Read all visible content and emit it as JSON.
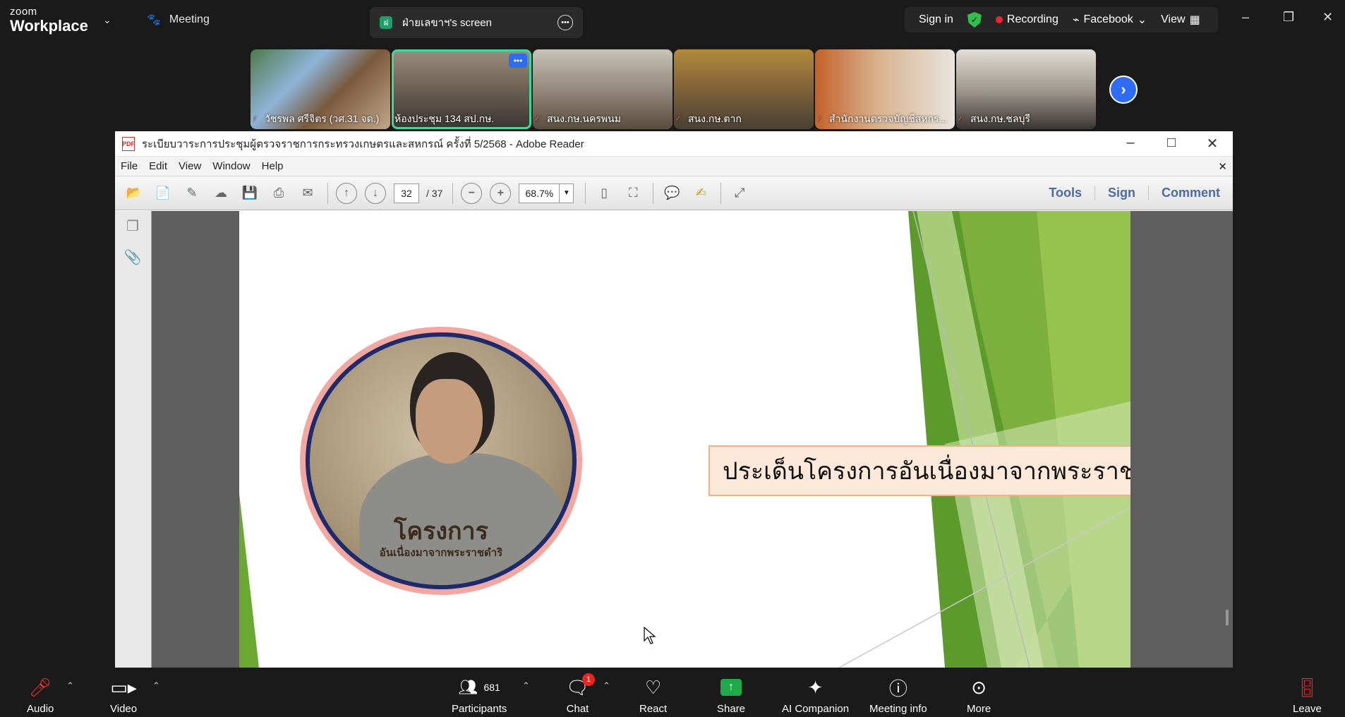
{
  "topbar": {
    "logo_small": "zoom",
    "logo_big": "Workplace",
    "meeting_label": "Meeting",
    "share_title": "ฝ่ายเลขาฯ's screen",
    "share_icon_letter": "ฝ",
    "sign_in": "Sign in",
    "recording": "Recording",
    "facebook": "Facebook",
    "view": "View"
  },
  "thumbnails": [
    {
      "name": "วัชรพล ศรีจิตร (วศ.31 จด.)",
      "muted": true
    },
    {
      "name": "ห้องประชุม 134 สป.กษ.",
      "muted": false,
      "active": true
    },
    {
      "name": "สนง.กษ.นครพนม",
      "muted": true
    },
    {
      "name": "สนง.กษ.ตาก",
      "muted": true
    },
    {
      "name": "สำนักงานตรวจบัญชีสหกร...",
      "muted": true
    },
    {
      "name": "สนง.กษ.ชลบุรี",
      "muted": true
    }
  ],
  "reader": {
    "title": "ระเบียบวาระการประชุมผู้ตรวจราชการกระทรวงเกษตรและสหกรณ์ ครั้งที่ 5/2568 - Adobe Reader",
    "menu": [
      "File",
      "Edit",
      "View",
      "Window",
      "Help"
    ],
    "page_current": "32",
    "page_total": "/ 37",
    "zoom": "68.7%",
    "right_tools": [
      "Tools",
      "Sign",
      "Comment"
    ]
  },
  "slide": {
    "title": "ประเด็นโครงการอันเนื่องมาจากพระราชดำริ",
    "portrait_text1": "โครงการ",
    "portrait_text2": "อันเนื่องมาจากพระราชดำริ"
  },
  "bottombar": {
    "audio": "Audio",
    "video": "Video",
    "participants": "Participants",
    "participants_count": "681",
    "chat": "Chat",
    "chat_badge": "1",
    "react": "React",
    "share": "Share",
    "ai": "AI Companion",
    "info": "Meeting info",
    "more": "More",
    "leave": "Leave"
  },
  "colors": {
    "accent_blue": "#2d6cf3",
    "active_green": "#3fd89a",
    "share_green": "#1faa4a",
    "reader_link": "#4c6c9d"
  }
}
